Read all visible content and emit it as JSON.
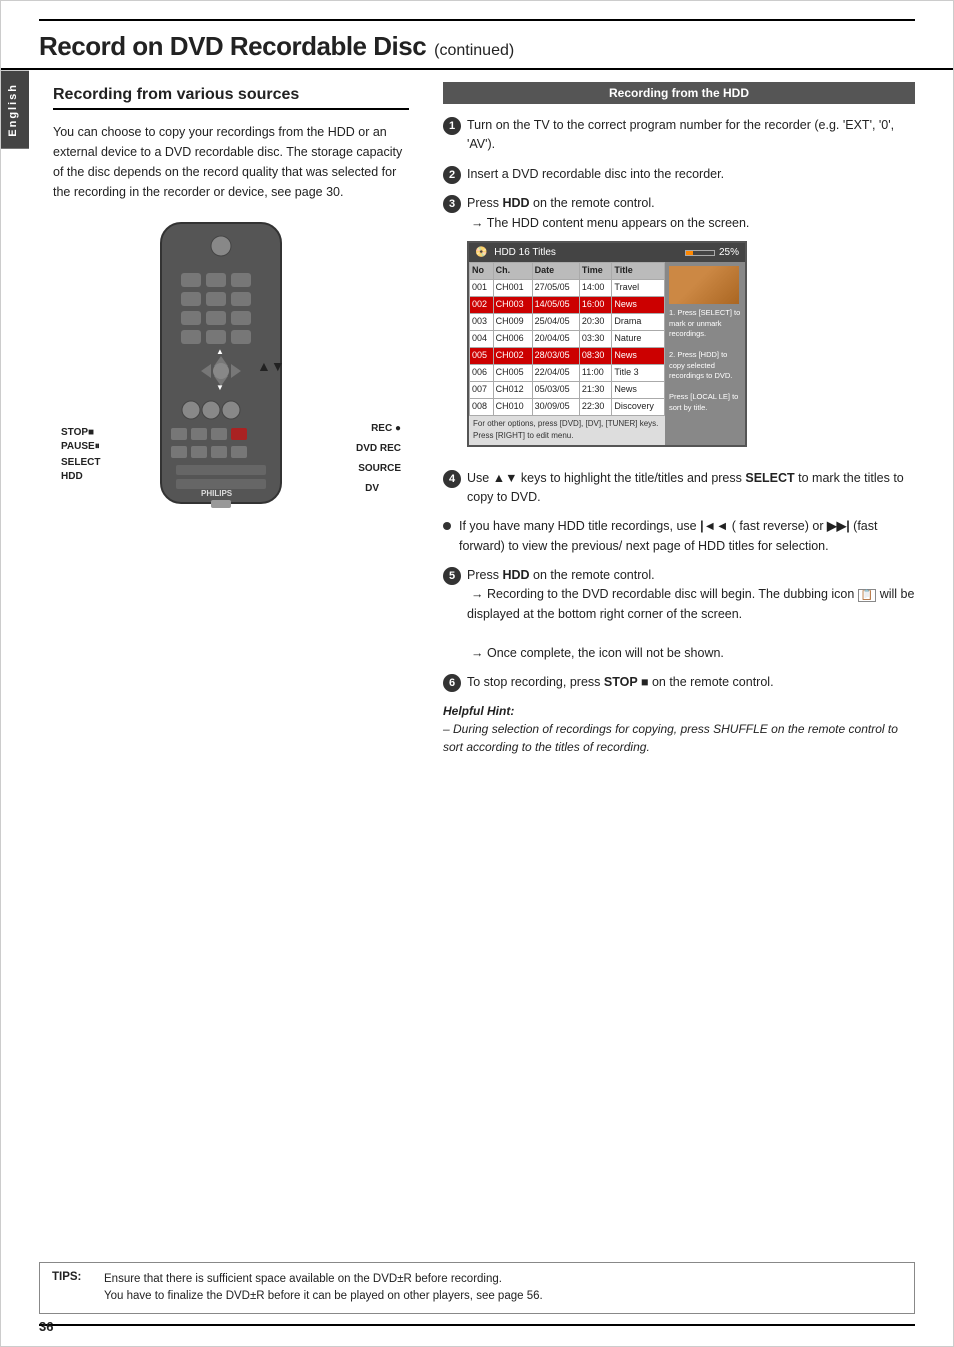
{
  "page": {
    "title_main": "Record on DVD Recordable Disc",
    "title_sub": "(continued)",
    "page_number": "36",
    "side_tab": "English"
  },
  "tips": {
    "label": "TIPS:",
    "line1": "Ensure that there is sufficient space available on the DVD±R before recording.",
    "line2": "You have to finalize the DVD±R before it can be played on other players, see page 56."
  },
  "left_section": {
    "title": "Recording from various sources",
    "body": "You can choose to copy your recordings from the HDD or an external device to a DVD recordable disc. The storage capacity of the disc depends on the record quality that was selected for the recording in the recorder or device, see page 30.",
    "remote_labels": {
      "stop_pause": "STOP■\nPAUSE⏸",
      "select_hdd": "SELECT\nHDD",
      "rec": "REC ●",
      "dvd_rec": "DVD REC",
      "source": "SOURCE",
      "dv": "DV"
    },
    "arrows": "▲▼"
  },
  "right_section": {
    "header": "Recording from the HDD",
    "steps": [
      {
        "num": "1",
        "text": "Turn on the TV to the correct program number for the recorder (e.g. 'EXT', '0', 'AV')."
      },
      {
        "num": "2",
        "text": "Insert a DVD recordable disc into the recorder."
      },
      {
        "num": "3",
        "text": "Press HDD on the remote control.",
        "sub": "→ The HDD content menu appears on the screen."
      },
      {
        "num": "4",
        "text": "Use ▲▼ keys to highlight the title/titles and press SELECT to mark the titles to copy to DVD."
      },
      {
        "num": "bullet",
        "text": "If you have many HDD title recordings, use |◄◄ ( fast reverse) or ▶▶| (fast forward) to view the previous/ next page of HDD titles for selection."
      },
      {
        "num": "5",
        "text": "Press HDD on the remote control.",
        "sub1": "→ Recording to the DVD recordable disc will begin. The dubbing icon will be displayed at the bottom right corner of the screen.",
        "sub2": "→ Once complete, the icon will not be shown."
      },
      {
        "num": "6",
        "text": "To stop recording, press STOP ■  on the remote control."
      }
    ],
    "helpful_hint_title": "Helpful Hint:",
    "helpful_hint_body": "– During selection of recordings for copying, press SHUFFLE on the remote control to sort according to the titles of recording.",
    "hdd_screen": {
      "title": "HDD 16 Titles",
      "percent": "25%",
      "rows": [
        {
          "no": "001",
          "ch": "CH001",
          "date": "27/05/05",
          "time": "14:00",
          "title": "Travel",
          "selected": false
        },
        {
          "no": "002",
          "ch": "CH003",
          "date": "14/05/05",
          "time": "16:00",
          "title": "News",
          "selected": true
        },
        {
          "no": "003",
          "ch": "CH009",
          "date": "25/04/05",
          "time": "20:30",
          "title": "Drama",
          "selected": false
        },
        {
          "no": "004",
          "ch": "CH006",
          "date": "20/04/05",
          "time": "03:30",
          "title": "Nature",
          "selected": false
        },
        {
          "no": "005",
          "ch": "CH002",
          "date": "28/03/05",
          "time": "08:30",
          "title": "News",
          "selected": true
        },
        {
          "no": "006",
          "ch": "CH005",
          "date": "22/04/05",
          "time": "11:00",
          "title": "Title 3",
          "selected": false
        },
        {
          "no": "007",
          "ch": "CH012",
          "date": "05/03/05",
          "time": "21:30",
          "title": "News",
          "selected": false
        },
        {
          "no": "008",
          "ch": "CH010",
          "date": "30/09/05",
          "time": "22:30",
          "title": "Discovery",
          "selected": false
        }
      ],
      "footer": "For other options, press [DVD], [DV], [TUNER] keys. Press [RIGHT] to edit menu.",
      "sidebar_text": "1. Press [SELECT] to mark or unmark recordings.\n2. Press [HDD] to copy selected recordings to DVD.\nPress [LOCAL LE] to sort by title."
    }
  }
}
